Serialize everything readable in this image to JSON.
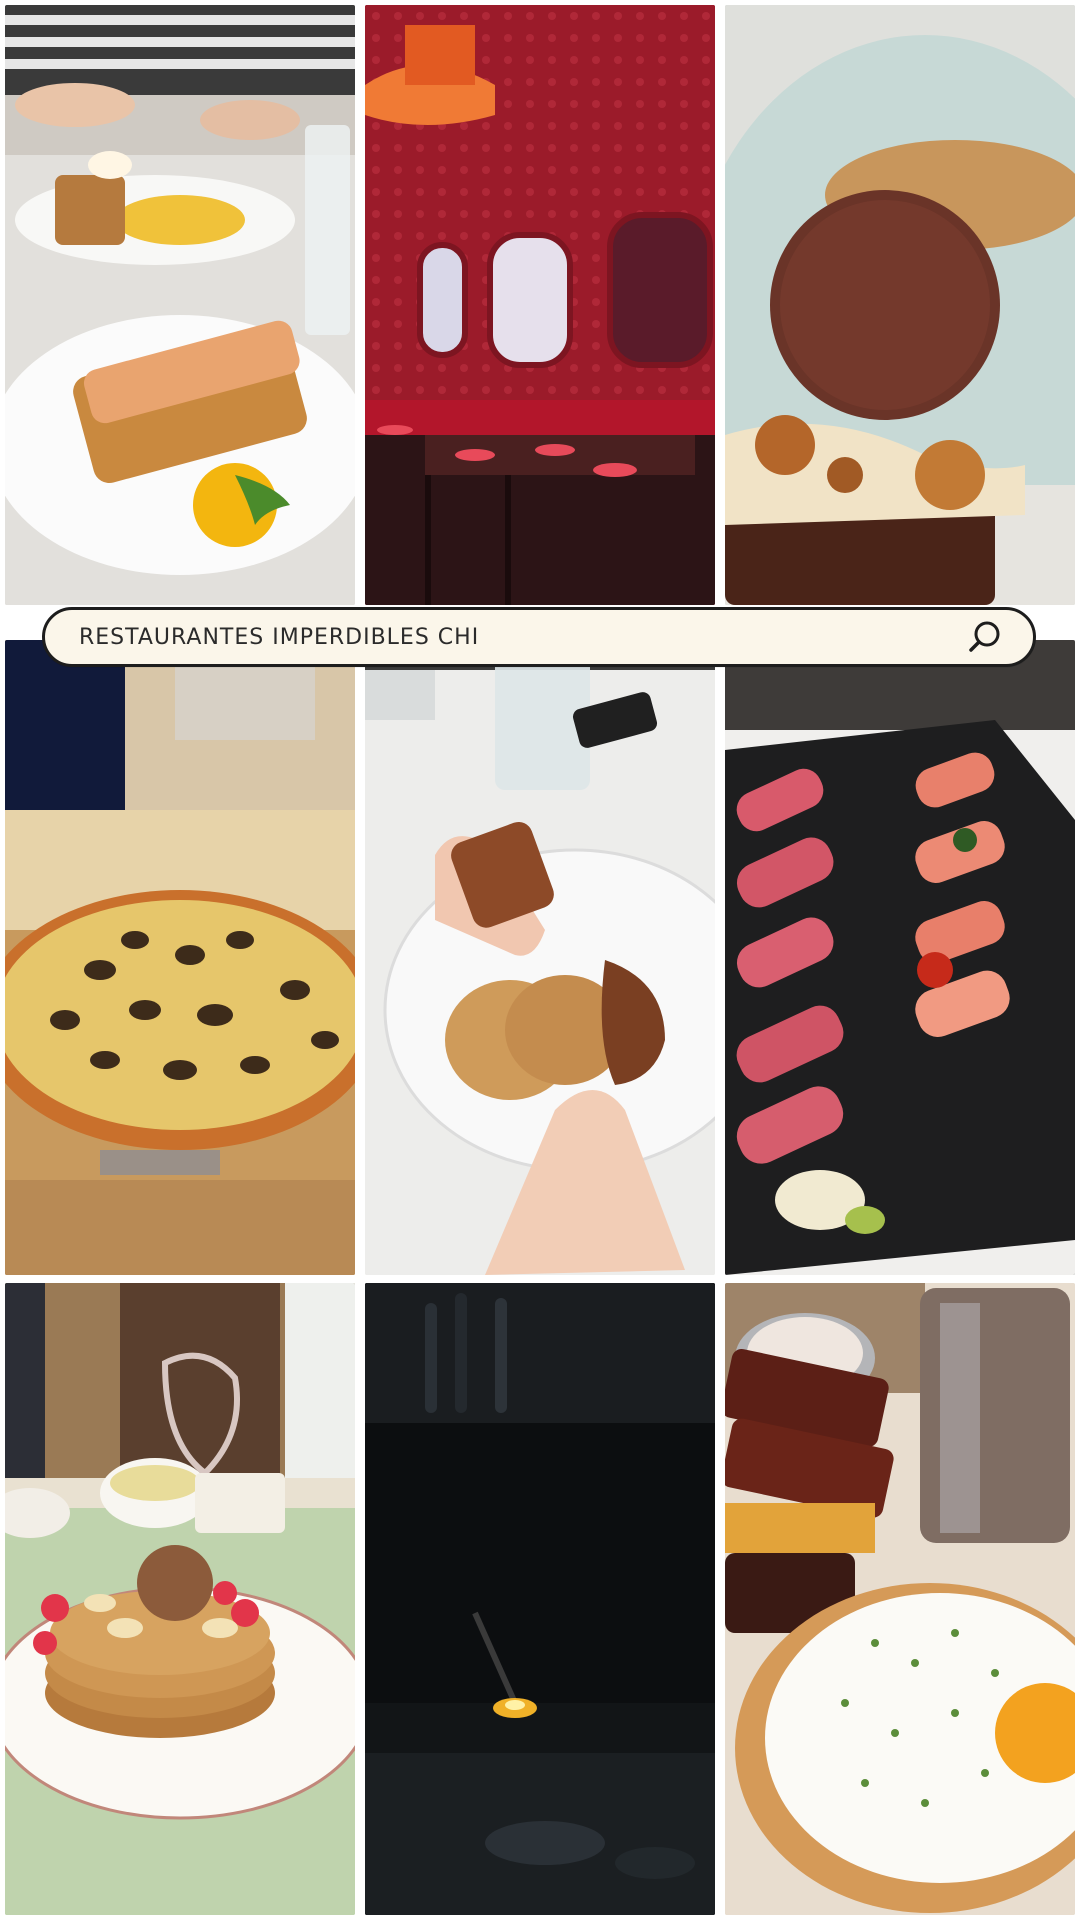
{
  "search": {
    "query": "RESTAURANTES IMPERDIBLES CHI",
    "icon": "search-icon"
  },
  "tiles": [
    {
      "name": "lobster-roll-plate",
      "depicts": "lobster roll"
    },
    {
      "name": "red-dining-room",
      "depicts": "restaurant interior"
    },
    {
      "name": "chocolate-dessert",
      "depicts": "dessert"
    },
    {
      "name": "truffle-pizza",
      "depicts": "pizza"
    },
    {
      "name": "cookie-hands",
      "depicts": "cookie"
    },
    {
      "name": "sushi-slate",
      "depicts": "sushi"
    },
    {
      "name": "pancakes-plate",
      "depicts": "pancakes"
    },
    {
      "name": "dark-bar-scene",
      "depicts": "bar"
    },
    {
      "name": "egg-toast-bacon",
      "depicts": "egg toast"
    }
  ],
  "colors": {
    "search_bg": "#fbf6ea",
    "search_border": "#1d1d1d"
  }
}
